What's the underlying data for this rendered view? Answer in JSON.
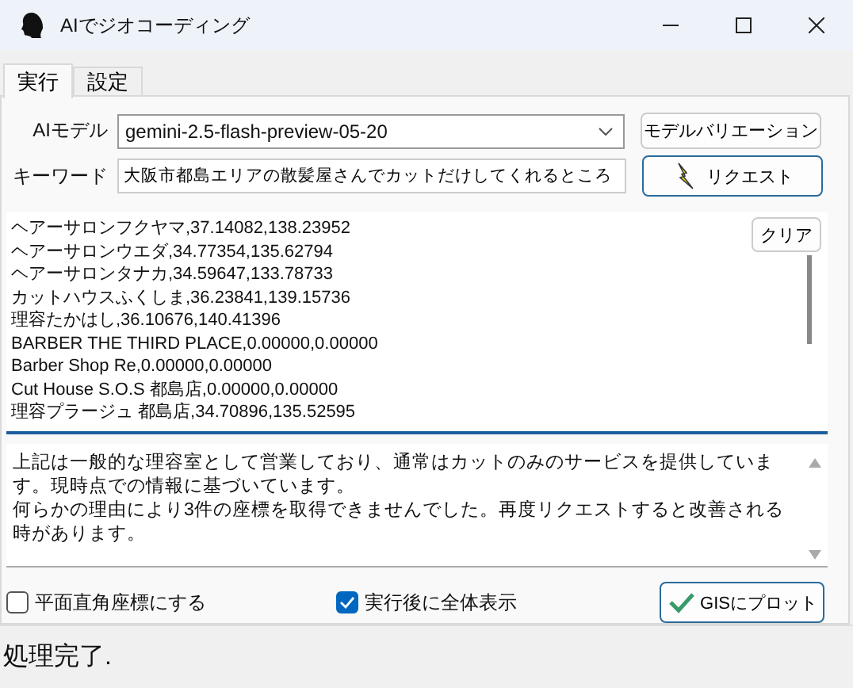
{
  "window": {
    "title": "AIでジオコーディング"
  },
  "tabs": [
    {
      "label": "実行",
      "selected": true
    },
    {
      "label": "設定",
      "selected": false
    }
  ],
  "model": {
    "label": "AIモデル",
    "value": "gemini-2.5-flash-preview-05-20",
    "button": "モデルバリエーション"
  },
  "keyword": {
    "label": "キーワード",
    "value": "大阪市都島エリアの散髪屋さんでカットだけしてくれるところ",
    "button": "リクエスト"
  },
  "results": {
    "clear_button": "クリア",
    "lines": [
      "ヘアーサロンフクヤマ,37.14082,138.23952",
      "ヘアーサロンウエダ,34.77354,135.62794",
      "ヘアーサロンタナカ,34.59647,133.78733",
      "カットハウスふくしま,36.23841,139.15736",
      "理容たかはし,36.10676,140.41396",
      "BARBER THE THIRD PLACE,0.00000,0.00000",
      "Barber Shop Re,0.00000,0.00000",
      "Cut House S.O.S 都島店,0.00000,0.00000",
      "理容プラージュ 都島店,34.70896,135.52595"
    ]
  },
  "message": [
    "上記は一般的な理容室として営業しており、通常はカットのみのサービスを提供しています。現時点での情報に基づいています。",
    "何らかの理由により3件の座標を取得できませんでした。再度リクエストすると改善される時があります。"
  ],
  "options": [
    {
      "label": "平面直角座標にする",
      "checked": false
    },
    {
      "label": "実行後に全体表示",
      "checked": true
    }
  ],
  "plot_button": "GISにプロット",
  "status_bar": "処理完了."
}
